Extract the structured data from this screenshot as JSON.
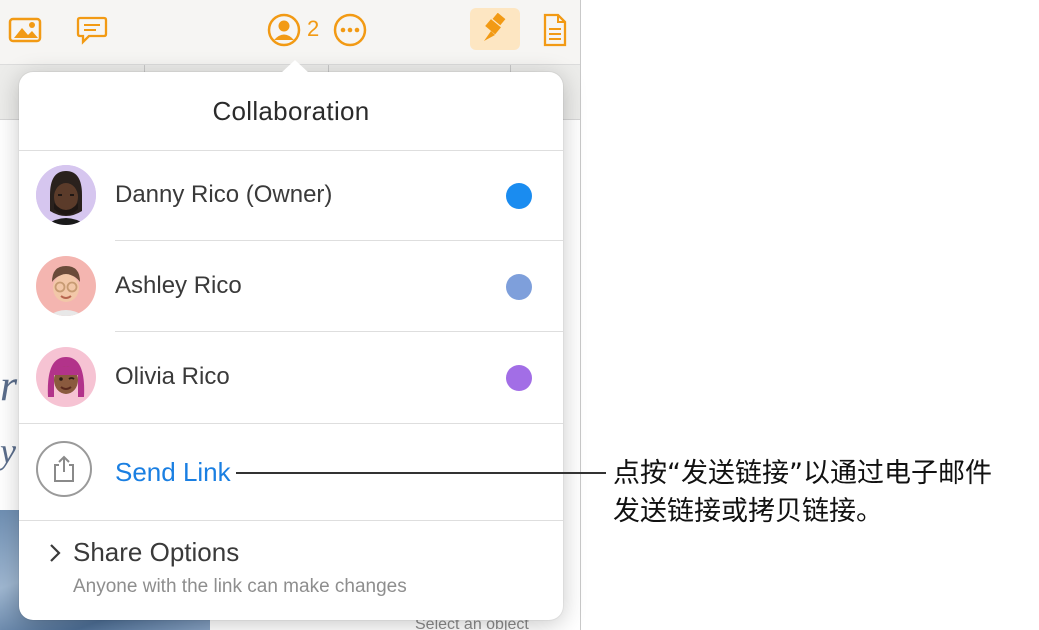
{
  "toolbar": {
    "icons": [
      "photo-icon",
      "comment-icon",
      "collaborators-icon",
      "more-icon",
      "format-brush-icon",
      "document-icon"
    ],
    "collaborator_count": "2"
  },
  "document": {
    "status_text": "Select an object"
  },
  "popover": {
    "title": "Collaboration",
    "participants": [
      {
        "name": "Danny Rico (Owner)",
        "color": "#1a8cf0",
        "avatar": "avatar-danny"
      },
      {
        "name": "Ashley Rico",
        "color": "#7e9fdb",
        "avatar": "avatar-ashley"
      },
      {
        "name": "Olivia Rico",
        "color": "#a26ee6",
        "avatar": "avatar-olivia"
      }
    ],
    "send_link_label": "Send Link",
    "share_options": {
      "title": "Share Options",
      "subtitle": "Anyone with the link can make changes"
    }
  },
  "callout": {
    "lines": [
      "点按“发送链接”以通过电子邮件",
      "发送链接或拷贝链接。"
    ]
  },
  "colors": {
    "accent": "#f29a14",
    "link": "#1a7fe2"
  }
}
